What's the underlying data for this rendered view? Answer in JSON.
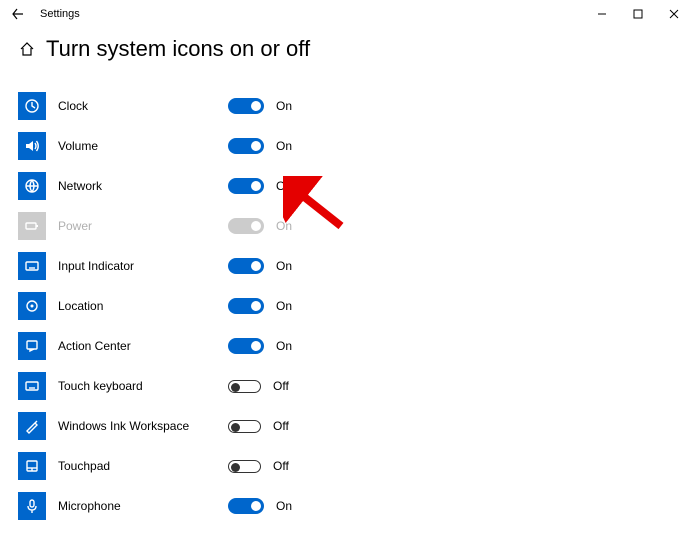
{
  "titlebar": {
    "title": "Settings"
  },
  "page": {
    "title": "Turn system icons on or off"
  },
  "labels": {
    "on": "On",
    "off": "Off"
  },
  "items": [
    {
      "id": "clock",
      "label": "Clock",
      "state": "on",
      "icon": "clock"
    },
    {
      "id": "volume",
      "label": "Volume",
      "state": "on",
      "icon": "volume"
    },
    {
      "id": "network",
      "label": "Network",
      "state": "on",
      "icon": "network"
    },
    {
      "id": "power",
      "label": "Power",
      "state": "disabled",
      "icon": "power"
    },
    {
      "id": "input-indicator",
      "label": "Input Indicator",
      "state": "on",
      "icon": "input"
    },
    {
      "id": "location",
      "label": "Location",
      "state": "on",
      "icon": "location"
    },
    {
      "id": "action-center",
      "label": "Action Center",
      "state": "on",
      "icon": "action"
    },
    {
      "id": "touch-keyboard",
      "label": "Touch keyboard",
      "state": "off",
      "icon": "keyboard"
    },
    {
      "id": "windows-ink",
      "label": "Windows Ink Workspace",
      "state": "off",
      "icon": "ink"
    },
    {
      "id": "touchpad",
      "label": "Touchpad",
      "state": "off",
      "icon": "touchpad"
    },
    {
      "id": "microphone",
      "label": "Microphone",
      "state": "on",
      "icon": "microphone"
    }
  ]
}
